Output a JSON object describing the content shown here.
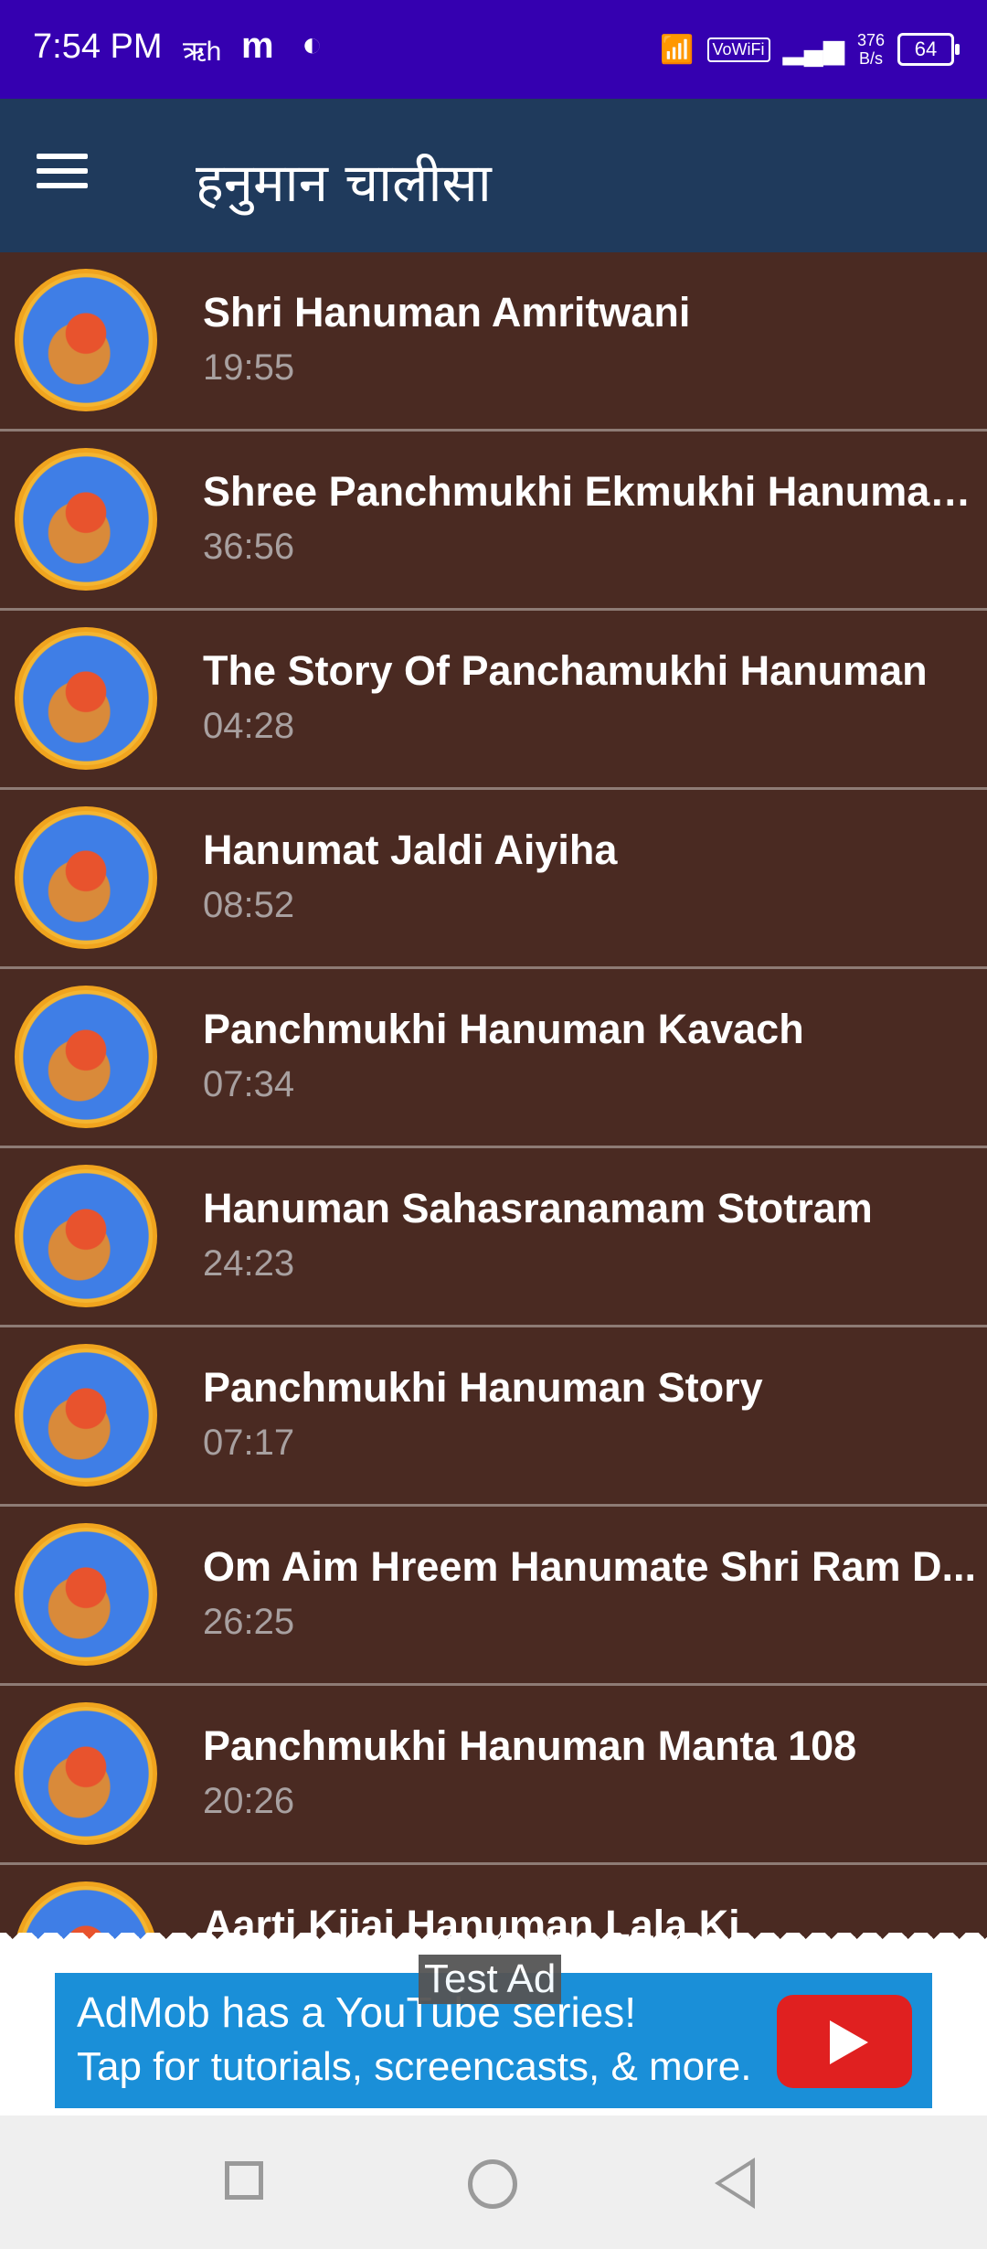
{
  "status_bar": {
    "time": "7:54 PM",
    "icons_left": [
      "ऋh",
      "m",
      "◐"
    ],
    "vowifi": "VoWiFi",
    "net_speed_value": "376",
    "net_speed_unit": "B/s",
    "battery": "64"
  },
  "app_bar": {
    "title": "हनुमान चालीसा"
  },
  "list": {
    "items": [
      {
        "title": "Shri Hanuman Amritwani",
        "duration": "19:55"
      },
      {
        "title": "Shree Panchmukhi Ekmukhi Hanuman...",
        "duration": "36:56"
      },
      {
        "title": "The Story Of Panchamukhi Hanuman",
        "duration": "04:28"
      },
      {
        "title": "Hanumat Jaldi Aiyiha",
        "duration": "08:52"
      },
      {
        "title": "Panchmukhi Hanuman Kavach",
        "duration": "07:34"
      },
      {
        "title": "Hanuman Sahasranamam Stotram",
        "duration": "24:23"
      },
      {
        "title": "Panchmukhi Hanuman Story",
        "duration": "07:17"
      },
      {
        "title": "Om Aim Hreem Hanumate Shri Ram D...",
        "duration": "26:25"
      },
      {
        "title": "Panchmukhi Hanuman Manta 108",
        "duration": "20:26"
      },
      {
        "title": "Aarti Kijai Hanuman Lala Ki",
        "duration": ""
      }
    ]
  },
  "ad": {
    "line1": "AdMob has a YouTube series!",
    "line2": "Tap for tutorials, screencasts, & more.",
    "test_label": "Test Ad"
  },
  "colors": {
    "status_bar": "#3500b0",
    "app_bar": "#1f3a5c",
    "list_bg": "#4a2a22",
    "ad_blue": "#1a8fd8"
  }
}
